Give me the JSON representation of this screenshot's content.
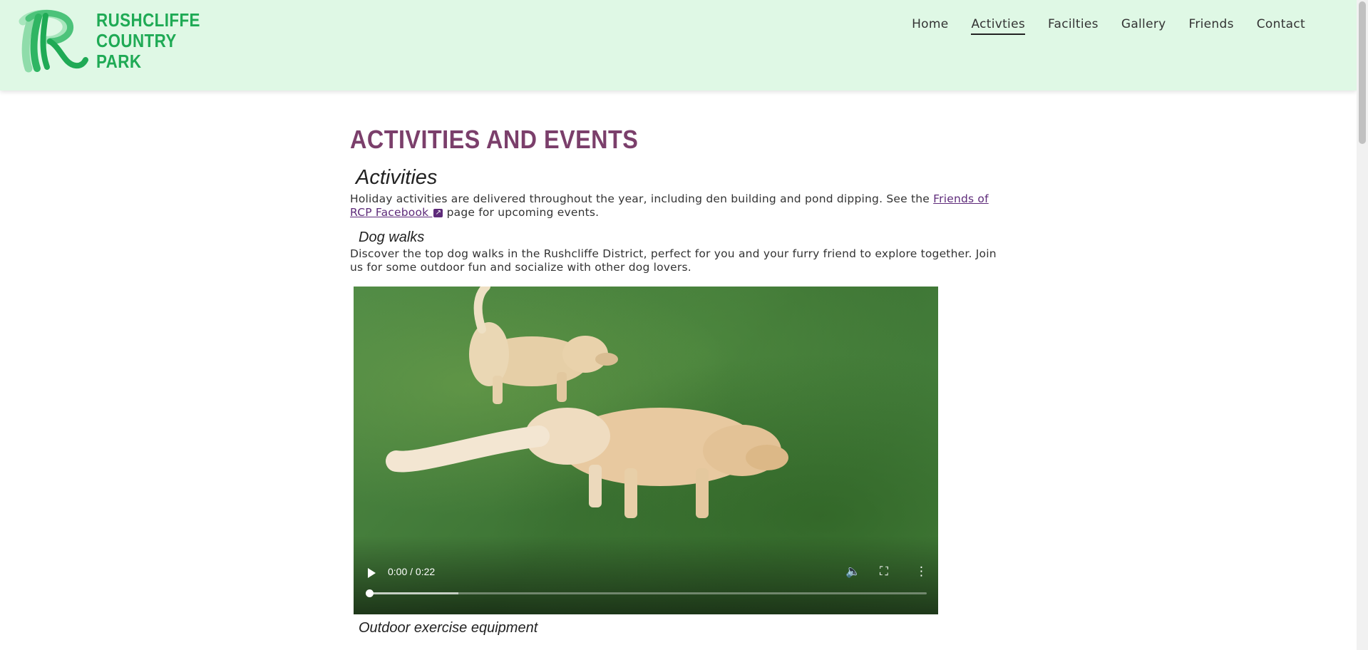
{
  "site": {
    "logo_lines": [
      "RUSHCLIFFE",
      "COUNTRY",
      "PARK"
    ],
    "brand_color": "#1faa55"
  },
  "nav": {
    "items": [
      "Home",
      "Activties",
      "Facilties",
      "Gallery",
      "Friends",
      "Contact"
    ],
    "active": "Activties"
  },
  "main": {
    "page_title": "ACTIVITIES AND EVENTS",
    "activities": {
      "heading": "Activities",
      "text_before": "Holiday activities are delivered throughout the year, including den building and pond dipping. See the ",
      "link_text": "Friends of RCP Facebook ",
      "text_after": " page for upcoming events."
    },
    "dog_walks": {
      "heading": "Dog walks",
      "text": "Discover the top dog walks in the Rushcliffe District, perfect for you and your furry friend to explore together. Join us for some outdoor fun and socialize with other dog lovers."
    },
    "video": {
      "time": "0:00 / 0:22",
      "buffered_fraction": 0.16,
      "played_fraction": 0
    },
    "outdoor": {
      "heading": "Outdoor exercise equipment"
    }
  },
  "colors": {
    "header_bg": "#dff8e5",
    "title": "#7b3f6b",
    "link": "#5e2b7a"
  }
}
